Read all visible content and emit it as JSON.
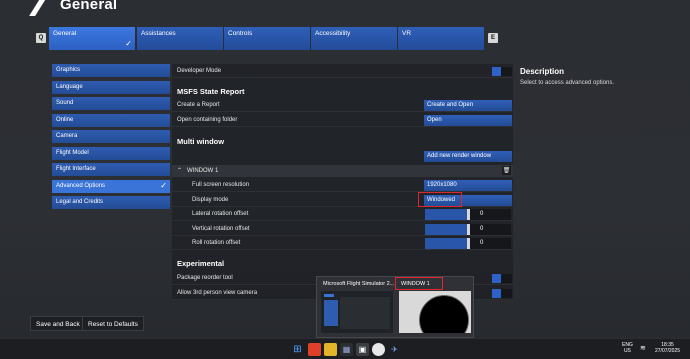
{
  "header": {
    "title": "General"
  },
  "tab_keys": {
    "left": "Q",
    "right": "E"
  },
  "tabs": [
    {
      "label": "General"
    },
    {
      "label": "Assistances"
    },
    {
      "label": "Controls"
    },
    {
      "label": "Accessibility"
    },
    {
      "label": "VR"
    }
  ],
  "menu": [
    {
      "label": "Graphics"
    },
    {
      "label": "Language"
    },
    {
      "label": "Sound"
    },
    {
      "label": "Online"
    },
    {
      "label": "Camera"
    },
    {
      "label": "Flight Model"
    },
    {
      "label": "Flight Interface"
    },
    {
      "label": "Advanced Options"
    },
    {
      "label": "Legal and Credits"
    }
  ],
  "settings": {
    "developer_mode": {
      "label": "Developer Mode",
      "enabled": true
    },
    "msfs_state_report": {
      "title": "MSFS State Report",
      "create_report": {
        "label": "Create a Report",
        "button": "Create and Open"
      },
      "open_folder": {
        "label": "Open containing folder",
        "button": "Open"
      }
    },
    "multi_window": {
      "title": "Multi window",
      "add_button": "Add new render window",
      "window_name": "WINDOW 1",
      "resolution": {
        "label": "Full screen resolution",
        "value": "1920x1080"
      },
      "display_mode": {
        "label": "Display mode",
        "value": "Windowed"
      },
      "lateral_offset": {
        "label": "Lateral rotation offset",
        "value": "0",
        "level": 0.5
      },
      "vertical_offset": {
        "label": "Vertical rotation offset",
        "value": "0",
        "level": 0.5
      },
      "roll_offset": {
        "label": "Roll rotation offset",
        "value": "0",
        "level": 0.5
      }
    },
    "experimental": {
      "title": "Experimental",
      "package_reorder": {
        "label": "Package reorder tool"
      },
      "third_person_camera": {
        "label": "Allow 3rd person view camera"
      }
    }
  },
  "description": {
    "title": "Description",
    "text": "Select to access advanced options."
  },
  "footer": {
    "save_back": "Save and Back",
    "reset_defaults": "Reset to Defaults"
  },
  "taskbar_preview": {
    "card1_title": "Microsoft Flight Simulator 2...",
    "card2_title": "WINDOW 1"
  },
  "tray": {
    "lang_line1": "ENG",
    "lang_line2": "US",
    "time": "18:35",
    "date": "27/07/2025"
  },
  "colors": {
    "accent": "#2f5fb8",
    "active": "#3a74d8",
    "highlight_box": "#e0262e"
  }
}
